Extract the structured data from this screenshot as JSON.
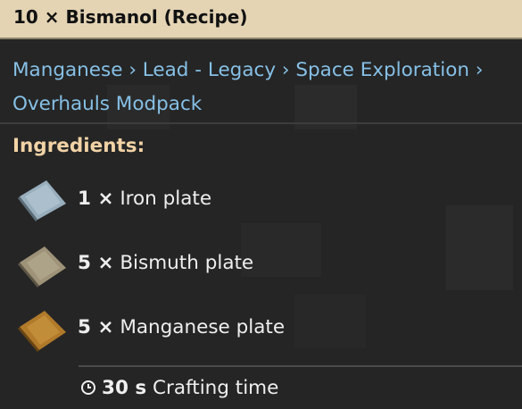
{
  "title": "10 × Bismanol (Recipe)",
  "breadcrumb": {
    "items": [
      "Manganese",
      "Lead - Legacy",
      "Space Exploration",
      "Overhauls Modpack"
    ],
    "separator": "›"
  },
  "ingredients_heading": "Ingredients:",
  "ingredients": [
    {
      "amount": "1 ×",
      "name": "Iron plate",
      "icon": "iron-plate-icon",
      "color": "#9eb3c2"
    },
    {
      "amount": "5 ×",
      "name": "Bismuth plate",
      "icon": "bismuth-plate-icon",
      "color": "#a69b7e"
    },
    {
      "amount": "5 ×",
      "name": "Manganese plate",
      "icon": "manganese-plate-icon",
      "color": "#b9812e"
    }
  ],
  "crafting": {
    "time": "30 s",
    "label": "Crafting time",
    "icon": "clock-icon"
  }
}
